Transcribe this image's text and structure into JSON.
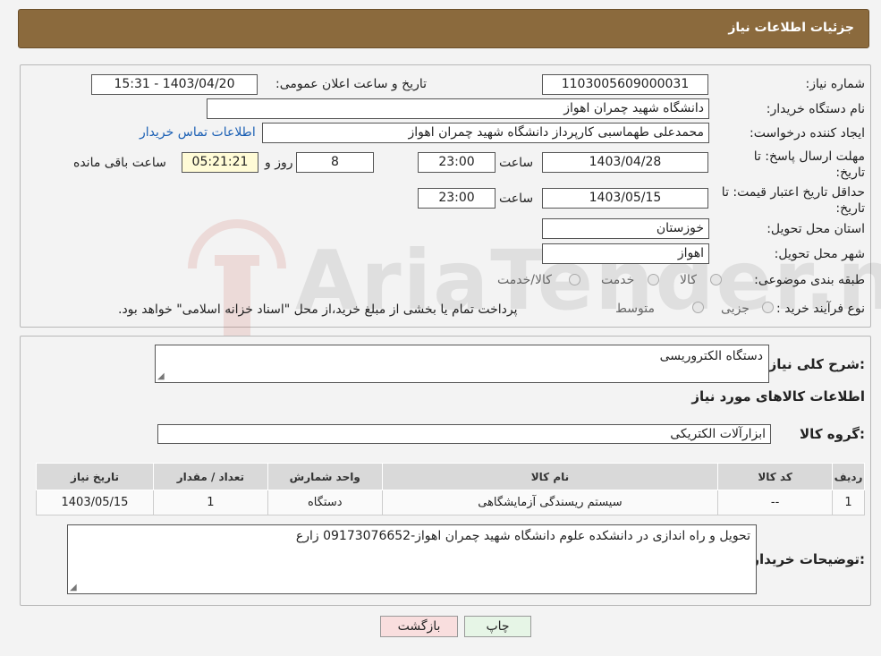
{
  "header": {
    "title": "جزئیات اطلاعات نیاز"
  },
  "form": {
    "need_number_label": "شماره نیاز:",
    "need_number": "1103005609000031",
    "announce_label": "تاریخ و ساعت اعلان عمومی:",
    "announce_value": "1403/04/20 - 15:31",
    "buyer_org_label": "نام دستگاه خریدار:",
    "buyer_org": "دانشگاه شهید چمران اهواز",
    "creator_label": "ایجاد کننده درخواست:",
    "creator": "محمدعلی طهماسبی کارپرداز دانشگاه شهید چمران اهواز",
    "contact_link": "اطلاعات تماس خریدار",
    "deadline_label": "مهلت ارسال پاسخ: تا تاریخ:",
    "deadline_date": "1403/04/28",
    "time_label": "ساعت",
    "deadline_time": "23:00",
    "days": "8",
    "days_label": "روز و",
    "remaining_time": "05:21:21",
    "remaining_label": "ساعت باقی مانده",
    "validity_label": "حداقل تاریخ اعتبار قیمت: تا تاریخ:",
    "validity_date": "1403/05/15",
    "validity_time": "23:00",
    "province_label": "استان محل تحویل:",
    "province": "خوزستان",
    "city_label": "شهر محل تحویل:",
    "city": "اهواز",
    "category_label": "طبقه بندی موضوعی:",
    "category_options": [
      "کالا",
      "خدمت",
      "کالا/خدمت"
    ],
    "process_label": "نوع فرآیند خرید :",
    "process_options": [
      "جزیی",
      "متوسط"
    ],
    "process_note": "پرداخت تمام یا بخشی از مبلغ خرید،از محل \"اسناد خزانه اسلامی\" خواهد بود."
  },
  "details": {
    "summary_label": "شرح کلی نیاز:",
    "summary": "دستگاه الکتروریسی",
    "items_title": "اطلاعات کالاهای مورد نیاز",
    "group_label": "گروه کالا:",
    "group": "ابزارآلات الکتریکی",
    "table": {
      "headers": [
        "ردیف",
        "کد کالا",
        "نام کالا",
        "واحد شمارش",
        "تعداد / مقدار",
        "تاریخ نیاز"
      ],
      "rows": [
        [
          "1",
          "--",
          "سیستم ریسندگی آزمایشگاهی",
          "دستگاه",
          "1",
          "1403/05/15"
        ]
      ]
    },
    "buyer_notes_label": "توضیحات خریدار:",
    "buyer_notes": "تحویل و راه اندازی در دانشکده علوم دانشگاه شهید چمران اهواز-09173076652 زارع"
  },
  "buttons": {
    "print": "چاپ",
    "back": "بازگشت"
  },
  "watermark": "AriaTender.neT",
  "colors": {
    "header": "#8b6a3d",
    "back_button": "#f9dede",
    "print_button": "#e6f5e6",
    "link": "#1a5fb4"
  }
}
